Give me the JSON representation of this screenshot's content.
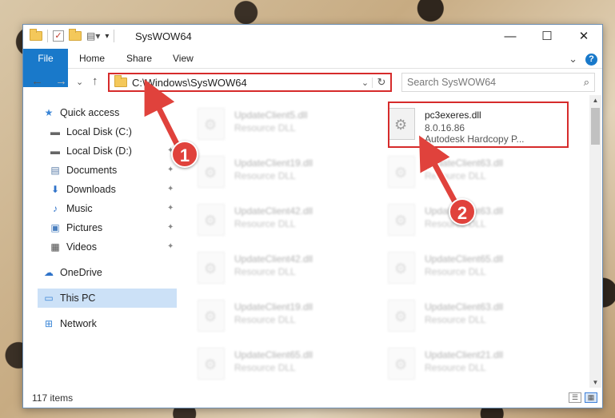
{
  "window": {
    "title": "SysWOW64",
    "minimize": "—",
    "maximize": "☐",
    "close": "✕"
  },
  "ribbon": {
    "tabs": [
      "File",
      "Home",
      "Share",
      "View"
    ],
    "expand": "⌄",
    "help": "?"
  },
  "nav": {
    "back": "←",
    "forward": "→",
    "recent": "⌄",
    "up": "↑",
    "address": "C:\\Windows\\SysWOW64",
    "address_dropdown": "⌄",
    "refresh": "↻",
    "search_placeholder": "Search SysWOW64",
    "search_icon": "⌕"
  },
  "sidebar": {
    "items": [
      {
        "label": "Quick access",
        "icon": "star-icon",
        "glyph": "★"
      },
      {
        "label": "Local Disk (C:)",
        "icon": "drive-icon",
        "glyph": "▬",
        "pin": "📌"
      },
      {
        "label": "Local Disk (D:)",
        "icon": "drive-icon",
        "glyph": "▬",
        "pin": "📌"
      },
      {
        "label": "Documents",
        "icon": "document-icon",
        "glyph": "▤",
        "pin": "📌"
      },
      {
        "label": "Downloads",
        "icon": "download-icon",
        "glyph": "⬇",
        "pin": "📌"
      },
      {
        "label": "Music",
        "icon": "music-icon",
        "glyph": "♪",
        "pin": "📌"
      },
      {
        "label": "Pictures",
        "icon": "pictures-icon",
        "glyph": "▣",
        "pin": "📌"
      },
      {
        "label": "Videos",
        "icon": "videos-icon",
        "glyph": "▦",
        "pin": "📌"
      },
      {
        "label": "OneDrive",
        "icon": "cloud-icon",
        "glyph": "☁"
      },
      {
        "label": "This PC",
        "icon": "computer-icon",
        "glyph": "▭"
      },
      {
        "label": "Network",
        "icon": "network-icon",
        "glyph": "⊞"
      }
    ]
  },
  "files": {
    "highlighted": {
      "name": "pc3exeres.dll",
      "version": "8.0.16.86",
      "description": "Autodesk Hardcopy P..."
    },
    "others": [
      {
        "name": "UpdateClient5.dll",
        "type": "Resource DLL"
      },
      {
        "name": "UpdateClient19.dll",
        "type": "Resource DLL"
      },
      {
        "name": "UpdateClient63.dll",
        "type": "Resource DLL"
      },
      {
        "name": "UpdateClient42.dll",
        "type": "Resource DLL"
      },
      {
        "name": "UpdateClient63.dll",
        "type": "Resource DLL"
      },
      {
        "name": "UpdateClient42.dll",
        "type": "Resource DLL"
      },
      {
        "name": "UpdateClient65.dll",
        "type": "Resource DLL"
      },
      {
        "name": "UpdateClient19.dll",
        "type": "Resource DLL"
      },
      {
        "name": "UpdateClient63.dll",
        "type": "Resource DLL"
      },
      {
        "name": "UpdateClient65.dll",
        "type": "Resource DLL"
      },
      {
        "name": "UpdateClient21.dll",
        "type": "Resource DLL"
      }
    ]
  },
  "status": {
    "item_count": "117 items"
  },
  "callouts": {
    "one": "1",
    "two": "2"
  },
  "colors": {
    "accent": "#1979ca",
    "highlight_red": "#d62b2b",
    "callout_red": "#e0423c",
    "selection": "#cce1f7"
  }
}
